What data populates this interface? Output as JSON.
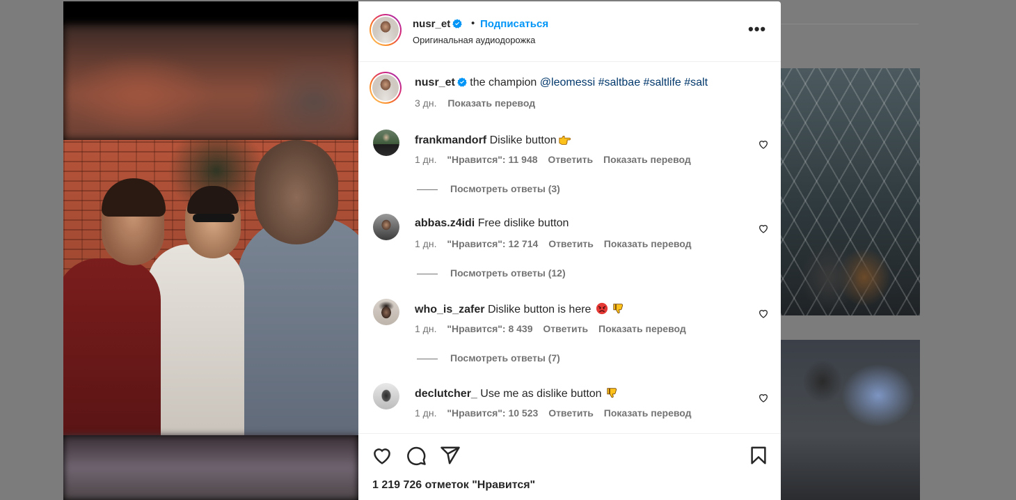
{
  "post": {
    "username": "nusr_et",
    "follow_label": "Подписаться",
    "separator": "•",
    "audio_label": "Оригинальная аудиодорожка",
    "more_label": "•••"
  },
  "caption": {
    "username": "nusr_et",
    "text": "the champion",
    "mention": "@leomessi",
    "hashtags": [
      "#saltbae",
      "#saltlife",
      "#salt"
    ],
    "time": "3 дн.",
    "translate_label": "Показать перевод"
  },
  "comments": [
    {
      "username": "frankmandorf",
      "text": "Dislike button",
      "emoji": [
        "hand-pointing-right-emoji"
      ],
      "time": "1 дн.",
      "likes": "\"Нравится\": 11 948",
      "reply_label": "Ответить",
      "translate_label": "Показать перевод",
      "replies_label": "Посмотреть ответы (3)"
    },
    {
      "username": "abbas.z4idi",
      "text": "Free dislike button",
      "emoji": [],
      "time": "1 дн.",
      "likes": "\"Нравится\": 12 714",
      "reply_label": "Ответить",
      "translate_label": "Показать перевод",
      "replies_label": "Посмотреть ответы (12)"
    },
    {
      "username": "who_is_zafer",
      "text": "Dislike button is here",
      "emoji": [
        "angry-face-emoji",
        "thumbs-down-emoji"
      ],
      "time": "1 дн.",
      "likes": "\"Нравится\": 8 439",
      "reply_label": "Ответить",
      "translate_label": "Показать перевод",
      "replies_label": "Посмотреть ответы (7)"
    },
    {
      "username": "declutcher_",
      "text": "Use me as dislike button",
      "emoji": [
        "thumbs-down-emoji"
      ],
      "time": "1 дн.",
      "likes": "\"Нравится\": 10 523",
      "reply_label": "Ответить",
      "translate_label": "Показать перевод"
    }
  ],
  "actions": {
    "icons": [
      "heart-icon",
      "comment-icon",
      "share-icon",
      "bookmark-icon"
    ],
    "likes_count": "1 219 726 отметок \"Нравится\""
  },
  "colors": {
    "accent": "#0095f6",
    "link": "#00376b",
    "muted": "#737373",
    "text": "#262626",
    "overlay": "#7c7c7c"
  }
}
